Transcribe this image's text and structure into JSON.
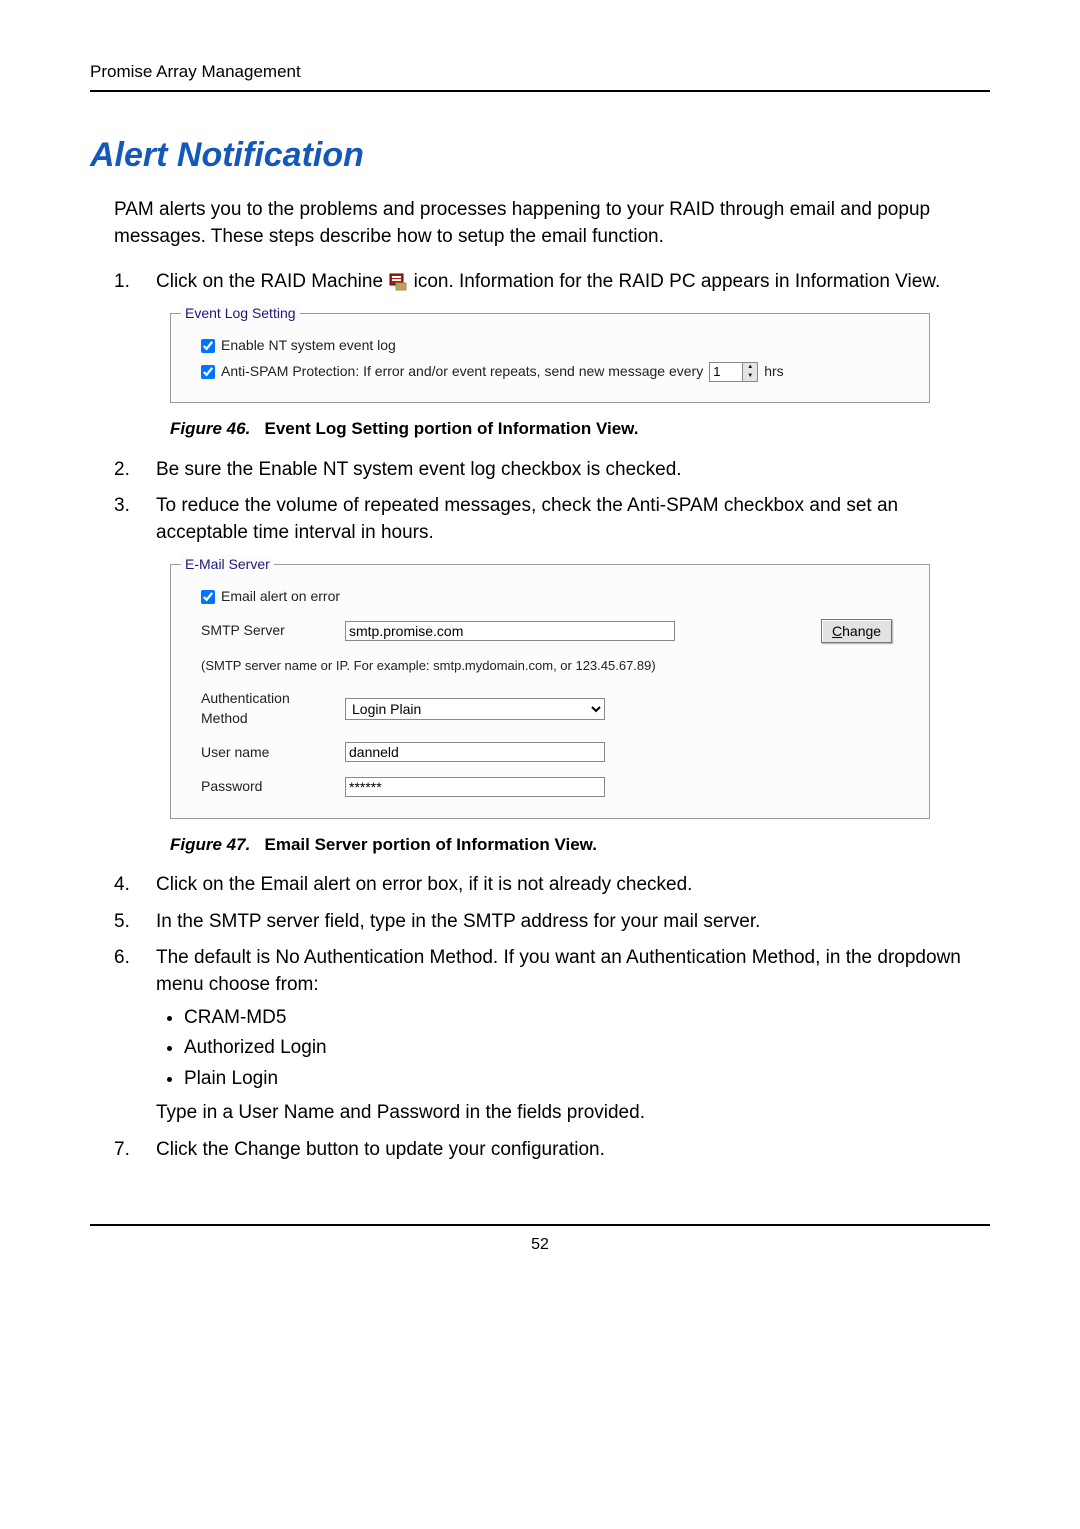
{
  "header": "Promise Array Management",
  "title": "Alert Notification",
  "intro": "PAM alerts you to the problems and processes happening to your RAID through email and popup messages. These steps describe how to setup the email function.",
  "steps": {
    "s1a": "Click on the RAID Machine ",
    "s1b": " icon. Information for the RAID PC appears in Information View.",
    "s2": "Be sure the Enable NT system event log checkbox is checked.",
    "s3": "To reduce the volume of repeated messages, check the Anti-SPAM checkbox and set an acceptable time interval in hours.",
    "s4": "Click on the Email alert on error box, if it is not already checked.",
    "s5": "In the SMTP server field, type in the SMTP address for your mail server.",
    "s6": "The default is No Authentication Method. If you want an Authentication Method, in the dropdown menu choose from:",
    "s6_bullets": [
      "CRAM-MD5",
      "Authorized Login",
      "Plain Login"
    ],
    "s6_tail": "Type in a User Name and Password in the fields provided.",
    "s7": "Click the Change button to update your configuration."
  },
  "fig46": {
    "caption_num": "Figure 46.",
    "caption_title": "Event Log Setting portion of Information View.",
    "legend": "Event Log Setting",
    "chk1": "Enable NT system event log",
    "chk2": "Anti-SPAM Protection: If error and/or event repeats, send new message every",
    "spin_value": "1",
    "unit": "hrs"
  },
  "fig47": {
    "caption_num": "Figure 47.",
    "caption_title": "Email Server portion of Information View.",
    "legend": "E-Mail Server",
    "chk": "Email alert on error",
    "row_smtp_label": "SMTP Server",
    "row_smtp_value": "smtp.promise.com",
    "hint": "(SMTP server name or IP. For example: smtp.mydomain.com, or 123.45.67.89)",
    "row_auth_label": "Authentication Method",
    "row_auth_value": "Login Plain",
    "row_user_label": "User name",
    "row_user_value": "danneld",
    "row_pass_label": "Password",
    "row_pass_value": "******",
    "change_btn_u": "C",
    "change_btn_rest": "hange"
  },
  "page_number": "52"
}
